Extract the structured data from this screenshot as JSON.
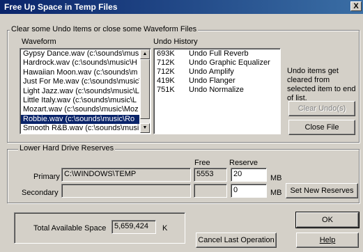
{
  "window": {
    "title": "Free Up Space in Temp Files",
    "close_label": "X"
  },
  "undo_group": {
    "legend": "Clear some Undo Items or close some Waveform Files",
    "waveform_header": "Waveform",
    "undo_history_header": "Undo History",
    "waveforms": [
      "Gypsy Dance.wav (c:\\sounds\\music\\",
      "Hardrock.wav (c:\\sounds\\music\\H",
      "Hawaiian Moon.wav (c:\\sounds\\m",
      "Just For Me.wav (c:\\sounds\\music\\",
      "Light Jazz.wav (c:\\sounds\\music\\L",
      "Little Italy.wav (c:\\sounds\\music\\L",
      "Mozart.wav (c:\\sounds\\music\\Moz",
      "Robbie.wav (c:\\sounds\\music\\Ro",
      "Smooth R&B.wav (c:\\sounds\\musi"
    ],
    "selected_index": 7,
    "undo_items": [
      {
        "size": "693K",
        "name": "Undo Full Reverb"
      },
      {
        "size": "712K",
        "name": "Undo Graphic Equalizer"
      },
      {
        "size": "712K",
        "name": "Undo Amplify"
      },
      {
        "size": "419K",
        "name": "Undo Flanger"
      },
      {
        "size": "751K",
        "name": "Undo Normalize"
      }
    ],
    "hint": "Undo items get cleared from selected item to end of list.",
    "clear_undo_label": "Clear Undo(s)",
    "close_file_label": "Close File"
  },
  "reserves": {
    "legend": "Lower Hard Drive Reserves",
    "free_header": "Free",
    "reserve_header": "Reserve",
    "primary_label": "Primary",
    "primary_path": "C:\\WINDOWS\\TEMP",
    "primary_free": "5553",
    "primary_reserve": "20",
    "secondary_label": "Secondary",
    "secondary_path": "",
    "secondary_free": "",
    "secondary_reserve": "0",
    "unit": "MB",
    "set_reserves_label": "Set New Reserves"
  },
  "footer": {
    "total_label": "Total Available Space",
    "total_value": "5,659,424",
    "total_unit": "K",
    "cancel_label": "Cancel Last Operation",
    "ok_label": "OK",
    "help_label": "Help"
  }
}
